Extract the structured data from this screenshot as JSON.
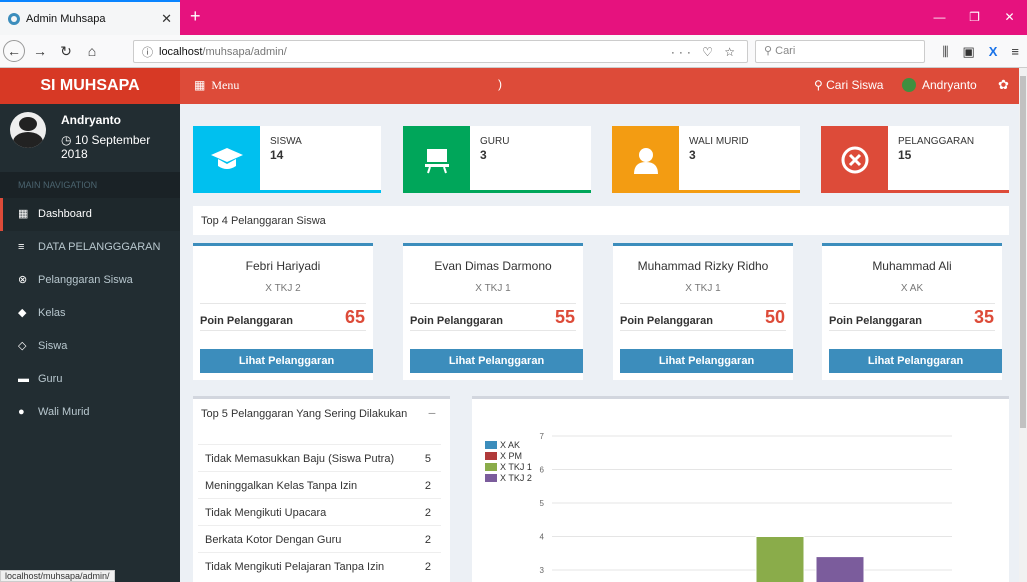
{
  "browser": {
    "tab_title": "Admin Muhsapa",
    "url_host": "localhost",
    "url_path": "/muhsapa/admin/",
    "search_placeholder": "Cari",
    "status_url": "localhost/muhsapa/admin/"
  },
  "header": {
    "logo": "SI MUHSAPA",
    "menu_label": "Menu",
    "search_label": "Cari Siswa",
    "user_name": "Andryanto"
  },
  "sidebar": {
    "user_name": "Andryanto",
    "date": "10 September 2018",
    "nav_header": "MAIN NAVIGATION",
    "items": [
      {
        "label": "Dashboard",
        "icon": "grid-icon"
      },
      {
        "label": "DATA PELANGGGARAN",
        "icon": "list-icon"
      },
      {
        "label": "Pelanggaran Siswa",
        "icon": "x-circle-icon"
      },
      {
        "label": "Kelas",
        "icon": "tag-icon"
      },
      {
        "label": "Siswa",
        "icon": "graduation-cap-icon"
      },
      {
        "label": "Guru",
        "icon": "desk-icon"
      },
      {
        "label": "Wali Murid",
        "icon": "user-icon"
      }
    ]
  },
  "stats": [
    {
      "label": "SISWA",
      "value": "14",
      "color": "#00c0ef",
      "icon": "graduation-cap-icon"
    },
    {
      "label": "GURU",
      "value": "3",
      "color": "#00a65a",
      "icon": "desk-icon"
    },
    {
      "label": "WALI MURID",
      "value": "3",
      "color": "#f39c12",
      "icon": "user-icon"
    },
    {
      "label": "PELANGGARAN",
      "value": "15",
      "color": "#dd4b39",
      "icon": "x-circle-icon"
    }
  ],
  "top4": {
    "title": "Top 4 Pelanggaran Siswa",
    "points_label": "Poin Pelanggaran",
    "button_label": "Lihat Pelanggaran",
    "students": [
      {
        "name": "Febri Hariyadi",
        "class": "X TKJ 2",
        "points": "65"
      },
      {
        "name": "Evan Dimas Darmono",
        "class": "X TKJ 1",
        "points": "55"
      },
      {
        "name": "Muhammad Rizky Ridho",
        "class": "X TKJ 1",
        "points": "50"
      },
      {
        "name": "Muhammad Ali",
        "class": "X AK",
        "points": "35"
      }
    ]
  },
  "top5": {
    "title": "Top 5 Pelanggaran Yang Sering Dilakukan",
    "rows": [
      {
        "text": "Tidak Memasukkan Baju (Siswa Putra)",
        "count": "5"
      },
      {
        "text": "Meninggalkan Kelas Tanpa Izin",
        "count": "2"
      },
      {
        "text": "Tidak Mengikuti Upacara",
        "count": "2"
      },
      {
        "text": "Berkata Kotor Dengan Guru",
        "count": "2"
      },
      {
        "text": "Tidak Mengikuti Pelajaran Tanpa Izin",
        "count": "2"
      }
    ]
  },
  "chart_data": {
    "type": "bar",
    "title": "",
    "xlabel": "",
    "ylabel": "",
    "ylim": [
      3,
      7
    ],
    "yticks": [
      3,
      4,
      5,
      6,
      7
    ],
    "legend_position": "top-left",
    "grid": true,
    "series": [
      {
        "name": "X AK",
        "color": "#3c8dbc",
        "value": null
      },
      {
        "name": "X PM",
        "color": "#b03a3a",
        "value": null
      },
      {
        "name": "X TKJ 1",
        "color": "#8aac4a",
        "value": 4
      },
      {
        "name": "X TKJ 2",
        "color": "#7b5c9c",
        "value": 3.4
      }
    ]
  }
}
